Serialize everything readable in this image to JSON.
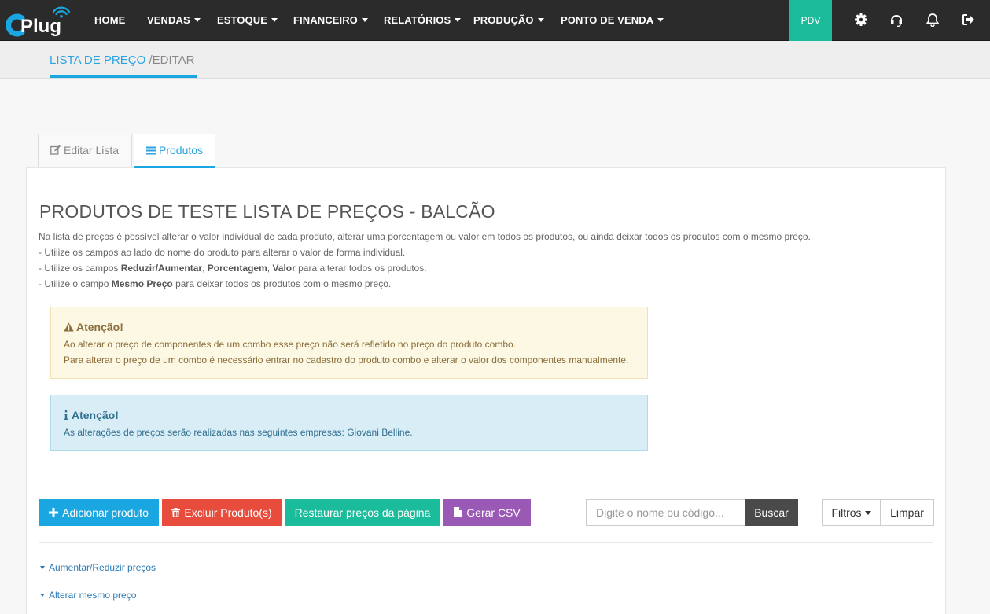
{
  "brand": {
    "logo_text": "CPlug",
    "accent": "#1aa6e0"
  },
  "nav": {
    "items": [
      {
        "label": "HOME",
        "dropdown": false
      },
      {
        "label": "VENDAS",
        "dropdown": true
      },
      {
        "label": "ESTOQUE",
        "dropdown": true
      },
      {
        "label": "FINANCEIRO",
        "dropdown": true
      },
      {
        "label": "RELATÓRIOS",
        "dropdown": true
      },
      {
        "label": "PRODUÇÃO",
        "dropdown": true
      },
      {
        "label": "PONTO DE VENDA",
        "dropdown": true
      }
    ],
    "pdv_label": "PDV",
    "icons": [
      "gear-icon",
      "headset-icon",
      "bell-icon",
      "logout-icon"
    ]
  },
  "breadcrumb": {
    "parent": "LISTA DE PREÇO",
    "separator": "/",
    "current": "EDITAR"
  },
  "tabs": [
    {
      "label": "Editar Lista",
      "icon": "edit-icon",
      "active": false
    },
    {
      "label": "Produtos",
      "icon": "list-icon",
      "active": true
    }
  ],
  "page": {
    "title": "PRODUTOS DE TESTE LISTA DE PREÇOS - BALCÃO",
    "description": {
      "line1": "Na lista de preços é possível alterar o valor individual de cada produto, alterar uma porcentagem ou valor em todos os produtos, ou ainda deixar todos os produtos com o mesmo preço.",
      "line2": "- Utilize os campos ao lado do nome do produto para alterar o valor de forma individual.",
      "line3_pre": "- Utilize os campos ",
      "line3_b1": "Reduzir/Aumentar",
      "line3_sep1": ", ",
      "line3_b2": "Porcentagem",
      "line3_sep2": ", ",
      "line3_b3": "Valor",
      "line3_post": " para alterar todos os produtos.",
      "line4_pre": "- Utilize o campo ",
      "line4_b": "Mesmo Preço",
      "line4_post": " para deixar todos os produtos com o mesmo preço."
    }
  },
  "alerts": {
    "warning": {
      "title": "Atenção!",
      "line1": "Ao alterar o preço de componentes de um combo esse preço não será refletido no preço do produto combo.",
      "line2": "Para alterar o preço de um combo é necessário entrar no cadastro do produto combo e alterar o valor dos componentes manualmente."
    },
    "info": {
      "title": "Atenção!",
      "line1": "As alterações de preços serão realizadas nas seguintes empresas: Giovani Belline."
    }
  },
  "toolbar": {
    "add_label": "Adicionar produto",
    "delete_label": "Excluir Produto(s)",
    "restore_label": "Restaurar preços da página",
    "csv_label": "Gerar CSV",
    "search_placeholder": "Digite o nome ou código...",
    "search_value": "",
    "search_button": "Buscar",
    "filters_label": "Filtros",
    "clear_label": "Limpar"
  },
  "collapsibles": [
    {
      "label": "Aumentar/Reduzir preços"
    },
    {
      "label": "Alterar mesmo preço"
    }
  ],
  "colors": {
    "navbar": "#2b2b2b",
    "pdv": "#1abc9c",
    "add": "#1aa6e0",
    "delete": "#e74c3c",
    "restore": "#1abc9c",
    "csv": "#9b59b6",
    "search": "#4a4a4a"
  }
}
